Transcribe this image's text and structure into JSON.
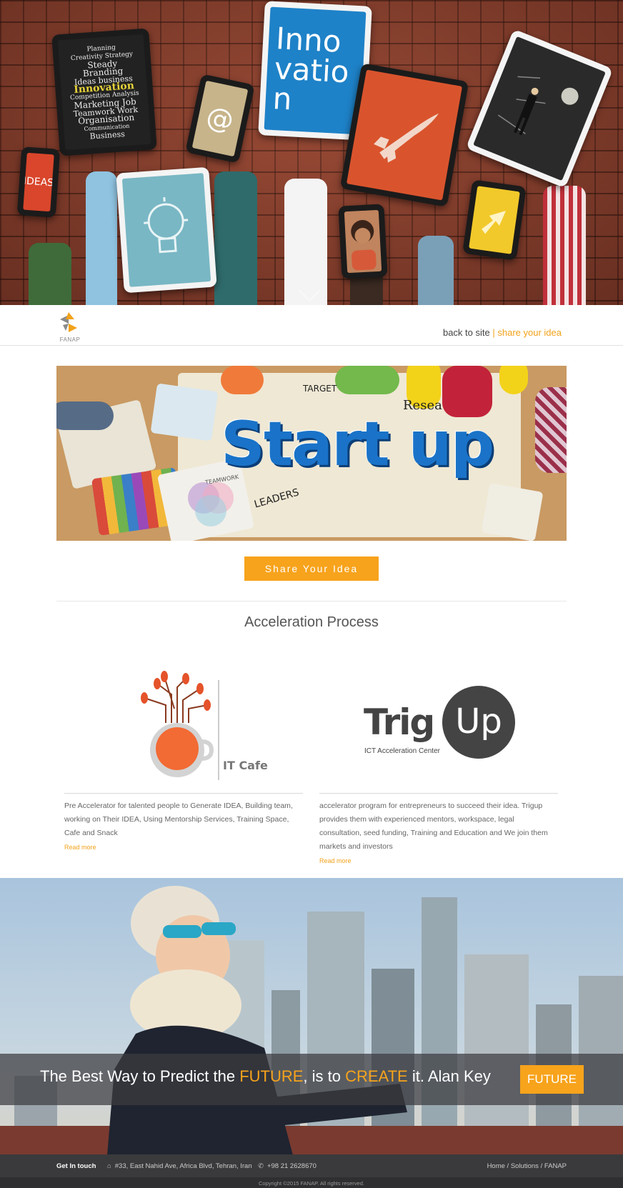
{
  "hero": {
    "screens": {
      "innovation": "Inno vatio n",
      "ideas": "IDEAS",
      "at": "@",
      "wordcloud": [
        "Planning",
        "Creativity Strategy",
        "Steady Branding",
        "Ideas business",
        "Innovation",
        "Competition Analysis",
        "Marketing Job",
        "Teamwork Work",
        "Organisation",
        "Communication",
        "Business"
      ]
    }
  },
  "nav": {
    "logo_text": "FANAP",
    "back_label": "back to site",
    "separator": "|",
    "share_label": "share your idea"
  },
  "banner": {
    "title": "Start up",
    "target": "TARGET",
    "research": "Resea",
    "leaders": "LEADERS",
    "teamwork": "TEAMWORK"
  },
  "cta": {
    "label": "Share Your Idea"
  },
  "section": {
    "title": "Acceleration Process"
  },
  "cards": [
    {
      "logo_text": "IT Cafe",
      "text": "Pre Accelerator for talented people to Generate IDEA, Building team, working on Their IDEA, Using Mentorship Services, Training Space, Cafe and Snack",
      "more": "Read more"
    },
    {
      "logo_word": "Trig",
      "logo_circle": "Up",
      "logo_sub": "ICT Acceleration Center",
      "text": "accelerator program for entrepreneurs to succeed their idea. Trigup provides them with experienced mentors, workspace, legal consultation, seed funding, Training and Education and We join them markets and investors",
      "more": "Read more"
    }
  ],
  "quote": {
    "part1": "The Best Way to Predict the ",
    "hl1": "FUTURE",
    "part2": ", is to ",
    "hl2": "CREATE",
    "part3": " it. Alan Key",
    "button": "FUTURE"
  },
  "footer": {
    "touch": "Get In touch",
    "address": "#33, East Nahid Ave, Africa Blvd, Tehran, Iran",
    "phone": "+98 21 2628670",
    "crumb_home": "Home",
    "crumb_sep": "/",
    "crumb_solutions": "Solutions",
    "crumb_fanap": "FANAP",
    "copyright": "Copyright ©2015 FANAP. All rights reserved."
  },
  "colors": {
    "accent": "#f7a31c",
    "footer": "#3a3a3c",
    "brick": "#8a3e2c"
  }
}
